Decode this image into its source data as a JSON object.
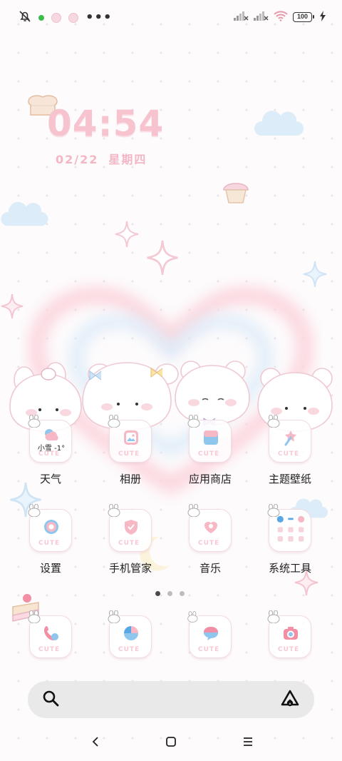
{
  "status_bar": {
    "battery_level": "100",
    "icons": [
      "bell-muted-icon",
      "notification-dot-icon",
      "app-notification-icon",
      "app-notification-icon",
      "more-icon",
      "signal-no-service-icon",
      "signal-no-service-icon",
      "wifi-icon",
      "battery-icon",
      "charging-icon"
    ]
  },
  "clock": {
    "time": "04:54",
    "date": "02/22",
    "weekday": "星期四"
  },
  "apps": [
    {
      "label": "天气",
      "icon": "weather-icon",
      "widget_text": "小雪 -1°"
    },
    {
      "label": "相册",
      "icon": "gallery-icon"
    },
    {
      "label": "应用商店",
      "icon": "app-store-icon"
    },
    {
      "label": "主题壁纸",
      "icon": "theme-brush-icon"
    },
    {
      "label": "设置",
      "icon": "settings-icon"
    },
    {
      "label": "手机管家",
      "icon": "security-shield-icon"
    },
    {
      "label": "音乐",
      "icon": "music-icon"
    },
    {
      "label": "系统工具",
      "icon": "system-tools-folder-icon"
    }
  ],
  "dock": [
    {
      "icon": "phone-icon"
    },
    {
      "icon": "browser-icon"
    },
    {
      "icon": "messages-icon"
    },
    {
      "icon": "camera-icon"
    }
  ],
  "app_badge_text": "CUTE",
  "pager": {
    "pages": 3,
    "active": 1
  },
  "search": {
    "placeholder": ""
  },
  "colors": {
    "accent_pink": "#f6c3cf",
    "text": "#1f1f1f",
    "search_bg": "#e9e9e9"
  }
}
